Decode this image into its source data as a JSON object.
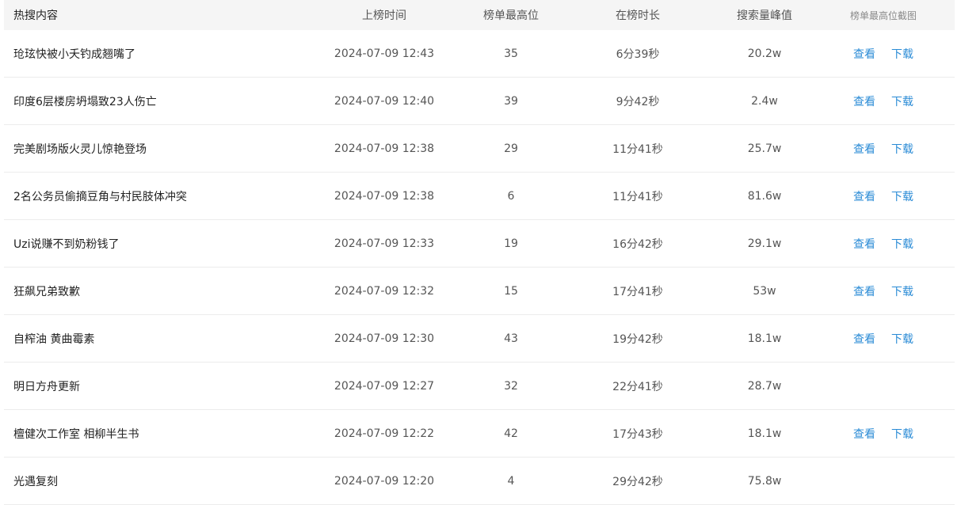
{
  "table": {
    "headers": {
      "title": "热搜内容",
      "time": "上榜时间",
      "rank": "榜单最高位",
      "duration": "在榜时长",
      "peak": "搜索量峰值",
      "screenshot": "榜单最高位截图"
    },
    "link_labels": {
      "view": "查看",
      "download": "下载"
    },
    "rows": [
      {
        "title": "玱玹快被小夭钓成翘嘴了",
        "time": "2024-07-09 12:43",
        "rank": "35",
        "duration": "6分39秒",
        "peak": "20.2w",
        "has_screenshot": true
      },
      {
        "title": "印度6层楼房坍塌致23人伤亡",
        "time": "2024-07-09 12:40",
        "rank": "39",
        "duration": "9分42秒",
        "peak": "2.4w",
        "has_screenshot": true
      },
      {
        "title": "完美剧场版火灵儿惊艳登场",
        "time": "2024-07-09 12:38",
        "rank": "29",
        "duration": "11分41秒",
        "peak": "25.7w",
        "has_screenshot": true
      },
      {
        "title": "2名公务员偷摘豆角与村民肢体冲突",
        "time": "2024-07-09 12:38",
        "rank": "6",
        "duration": "11分41秒",
        "peak": "81.6w",
        "has_screenshot": true
      },
      {
        "title": "Uzi说赚不到奶粉钱了",
        "time": "2024-07-09 12:33",
        "rank": "19",
        "duration": "16分42秒",
        "peak": "29.1w",
        "has_screenshot": true
      },
      {
        "title": "狂飙兄弟致歉",
        "time": "2024-07-09 12:32",
        "rank": "15",
        "duration": "17分41秒",
        "peak": "53w",
        "has_screenshot": true
      },
      {
        "title": "自榨油 黄曲霉素",
        "time": "2024-07-09 12:30",
        "rank": "43",
        "duration": "19分42秒",
        "peak": "18.1w",
        "has_screenshot": true
      },
      {
        "title": "明日方舟更新",
        "time": "2024-07-09 12:27",
        "rank": "32",
        "duration": "22分41秒",
        "peak": "28.7w",
        "has_screenshot": false
      },
      {
        "title": "檀健次工作室 相柳半生书",
        "time": "2024-07-09 12:22",
        "rank": "42",
        "duration": "17分43秒",
        "peak": "18.1w",
        "has_screenshot": true
      },
      {
        "title": "光遇复刻",
        "time": "2024-07-09 12:20",
        "rank": "4",
        "duration": "29分42秒",
        "peak": "75.8w",
        "has_screenshot": false
      }
    ]
  }
}
